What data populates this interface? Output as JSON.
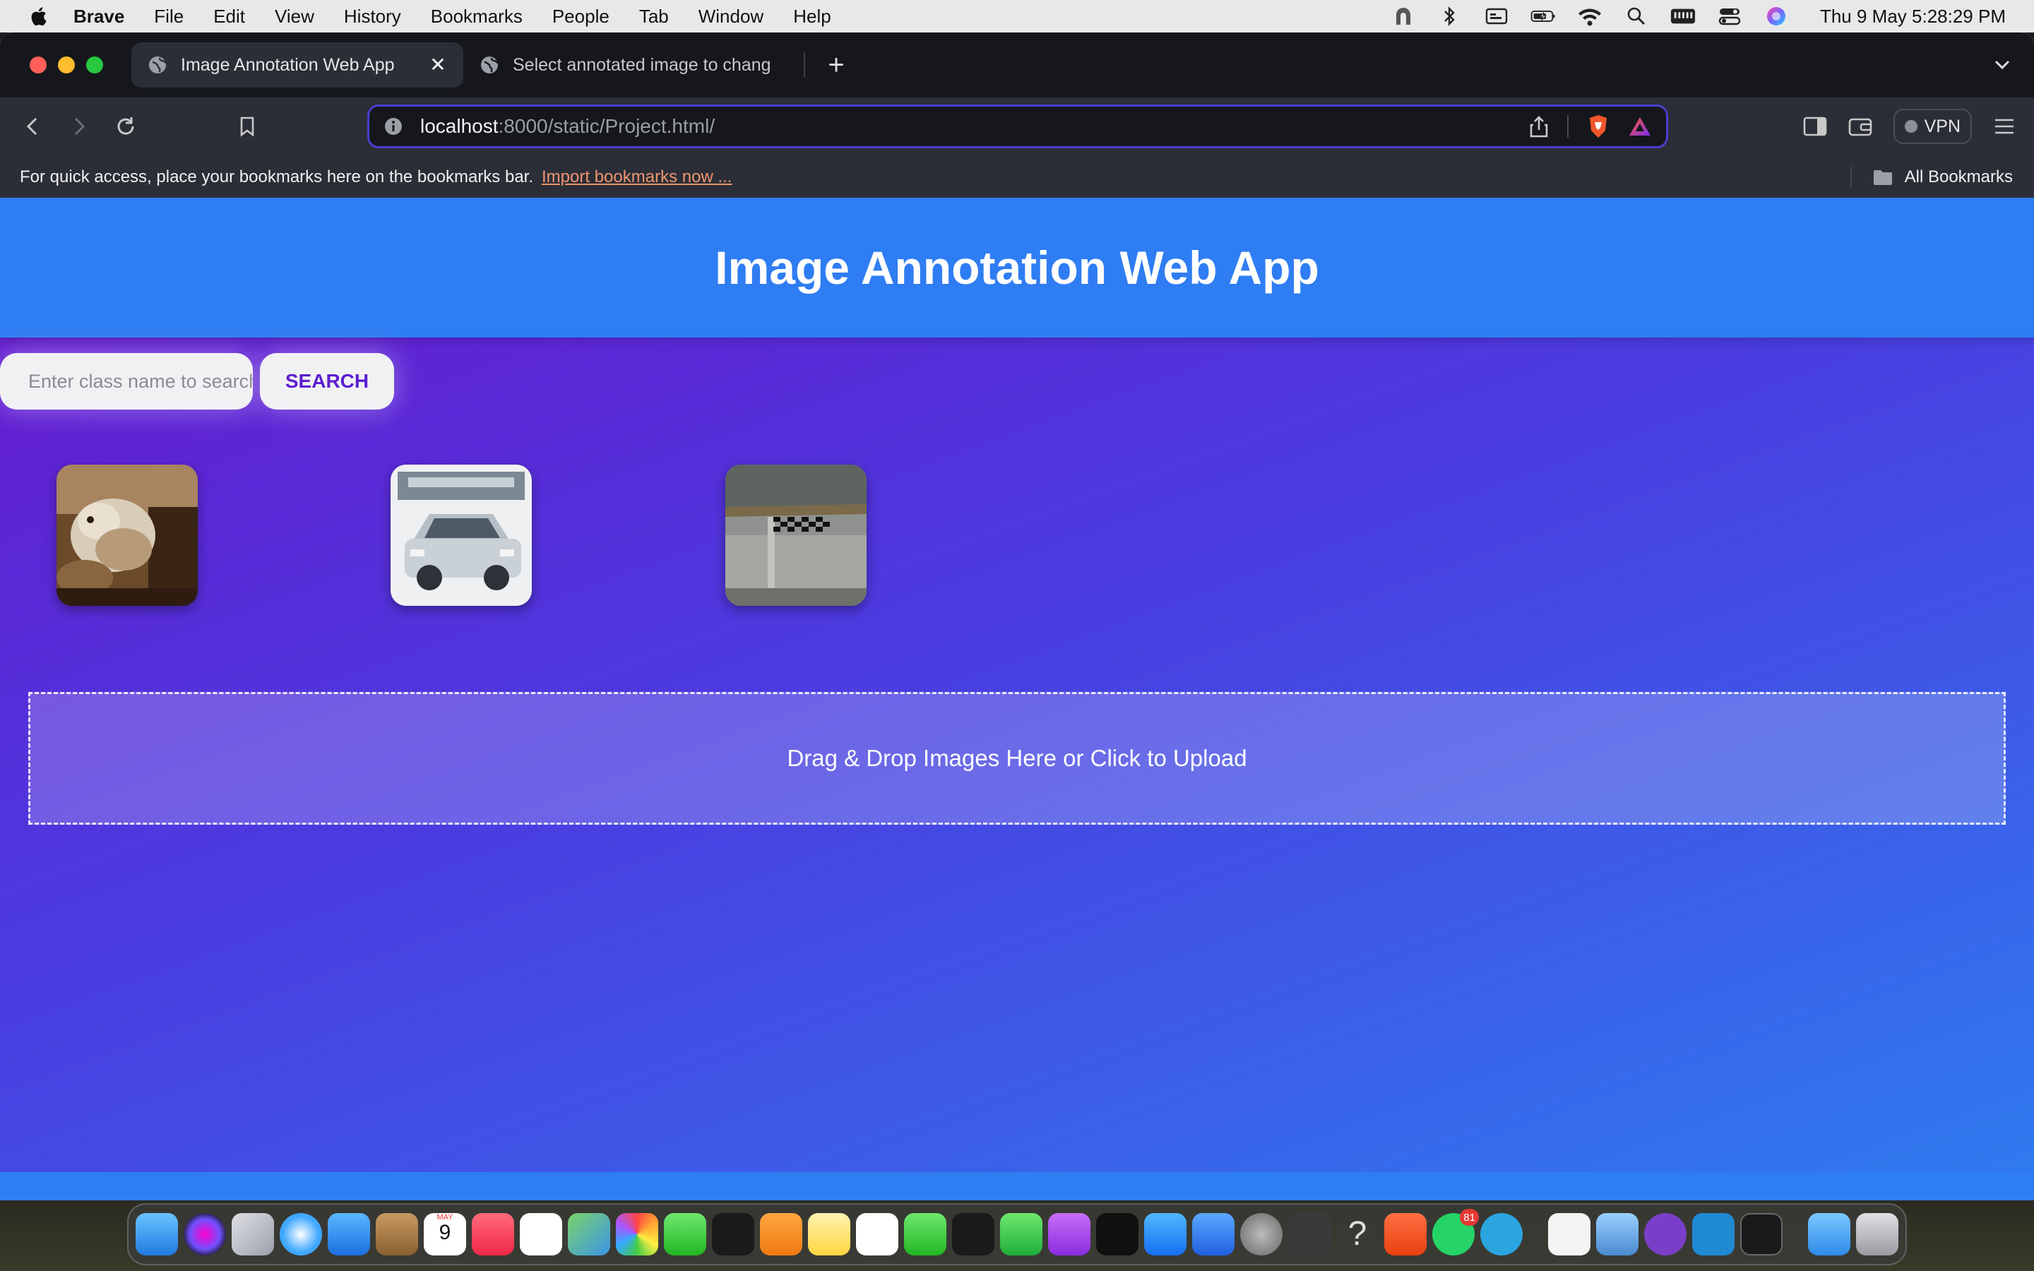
{
  "menubar": {
    "app_name": "Brave",
    "items": [
      "File",
      "Edit",
      "View",
      "History",
      "Bookmarks",
      "People",
      "Tab",
      "Window",
      "Help"
    ],
    "clock": "Thu 9 May  5:28:29 PM"
  },
  "tabs": [
    {
      "title": "Image Annotation Web App",
      "active": true
    },
    {
      "title": "Select annotated image to change",
      "active": false
    }
  ],
  "address_bar": {
    "host": "localhost",
    "rest": ":8000/static/Project.html/"
  },
  "toolbar": {
    "vpn_label": "VPN"
  },
  "bookmarks_bar": {
    "hint": "For quick access, place your bookmarks here on the bookmarks bar.",
    "import_link": "Import bookmarks now ...",
    "all_bookmarks": "All Bookmarks"
  },
  "app": {
    "title": "Image Annotation Web App",
    "search": {
      "placeholder": "Enter class name to search",
      "button": "SEARCH"
    },
    "thumbnails": [
      {
        "subject": "cat"
      },
      {
        "subject": "car"
      },
      {
        "subject": "road with checkerboard"
      }
    ],
    "dropzone_text": "Drag & Drop Images Here or Click to Upload"
  },
  "dock": {
    "calendar_month": "MAY",
    "calendar_day": "9",
    "whatsapp_badge": "81",
    "icons": [
      "finder-icon",
      "siri-icon",
      "launchpad-icon",
      "safari-icon",
      "mail-icon",
      "contacts-icon",
      "calendar-icon",
      "music-icon",
      "reminders-icon",
      "maps-icon",
      "photos-icon",
      "messages-icon",
      "stocks-icon",
      "pages-icon",
      "notes-icon",
      "freeform-icon",
      "facetime-icon",
      "voice-memos-icon",
      "numbers-icon",
      "podcasts-icon",
      "apple-tv-icon",
      "app-store-icon",
      "keynote-icon",
      "system-settings-icon",
      "calculator-icon",
      "help-icon",
      "brave-icon",
      "whatsapp-icon",
      "telegram-icon",
      "textedit-icon",
      "preview-icon",
      "github-desktop-icon",
      "vscode-icon",
      "terminal-icon",
      "downloads-folder-icon",
      "trash-icon"
    ]
  }
}
